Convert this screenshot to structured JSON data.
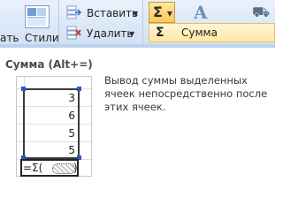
{
  "ribbon": {
    "left_label": "ать",
    "styles_label": "Стили",
    "insert_label": "Вставить",
    "delete_label": "Удалить",
    "sum_symbol": "Σ",
    "a_symbol": "A"
  },
  "menu": {
    "sum_item_symbol": "Σ",
    "sum_item_label": "Сумма"
  },
  "tooltip": {
    "title": "Сумма (Alt+=)",
    "description": "Вывод суммы выделенных ячеек непосредственно после этих ячеек."
  },
  "illustration": {
    "values": [
      "3",
      "6",
      "5",
      "5"
    ],
    "formula_prefix": "=Σ(",
    "formula_suffix": ")"
  },
  "colors": {
    "accent": "#ffc75c",
    "selection_handle": "#2f55c5"
  }
}
